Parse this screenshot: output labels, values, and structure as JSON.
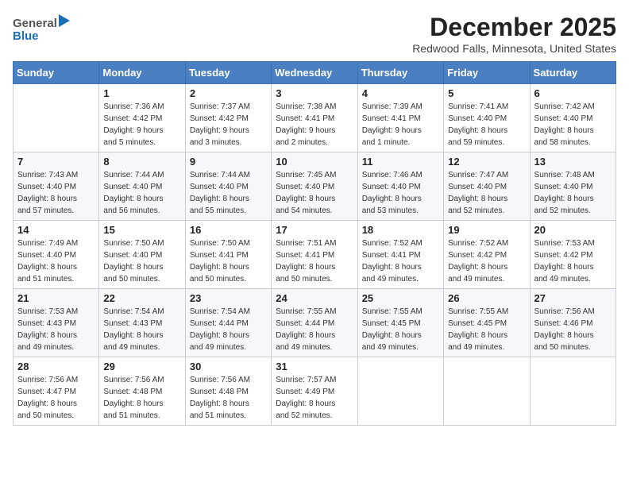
{
  "header": {
    "logo_general": "General",
    "logo_blue": "Blue",
    "month_title": "December 2025",
    "location": "Redwood Falls, Minnesota, United States"
  },
  "weekdays": [
    "Sunday",
    "Monday",
    "Tuesday",
    "Wednesday",
    "Thursday",
    "Friday",
    "Saturday"
  ],
  "weeks": [
    [
      {
        "day": "",
        "info": ""
      },
      {
        "day": "1",
        "info": "Sunrise: 7:36 AM\nSunset: 4:42 PM\nDaylight: 9 hours\nand 5 minutes."
      },
      {
        "day": "2",
        "info": "Sunrise: 7:37 AM\nSunset: 4:42 PM\nDaylight: 9 hours\nand 3 minutes."
      },
      {
        "day": "3",
        "info": "Sunrise: 7:38 AM\nSunset: 4:41 PM\nDaylight: 9 hours\nand 2 minutes."
      },
      {
        "day": "4",
        "info": "Sunrise: 7:39 AM\nSunset: 4:41 PM\nDaylight: 9 hours\nand 1 minute."
      },
      {
        "day": "5",
        "info": "Sunrise: 7:41 AM\nSunset: 4:40 PM\nDaylight: 8 hours\nand 59 minutes."
      },
      {
        "day": "6",
        "info": "Sunrise: 7:42 AM\nSunset: 4:40 PM\nDaylight: 8 hours\nand 58 minutes."
      }
    ],
    [
      {
        "day": "7",
        "info": "Sunrise: 7:43 AM\nSunset: 4:40 PM\nDaylight: 8 hours\nand 57 minutes."
      },
      {
        "day": "8",
        "info": "Sunrise: 7:44 AM\nSunset: 4:40 PM\nDaylight: 8 hours\nand 56 minutes."
      },
      {
        "day": "9",
        "info": "Sunrise: 7:44 AM\nSunset: 4:40 PM\nDaylight: 8 hours\nand 55 minutes."
      },
      {
        "day": "10",
        "info": "Sunrise: 7:45 AM\nSunset: 4:40 PM\nDaylight: 8 hours\nand 54 minutes."
      },
      {
        "day": "11",
        "info": "Sunrise: 7:46 AM\nSunset: 4:40 PM\nDaylight: 8 hours\nand 53 minutes."
      },
      {
        "day": "12",
        "info": "Sunrise: 7:47 AM\nSunset: 4:40 PM\nDaylight: 8 hours\nand 52 minutes."
      },
      {
        "day": "13",
        "info": "Sunrise: 7:48 AM\nSunset: 4:40 PM\nDaylight: 8 hours\nand 52 minutes."
      }
    ],
    [
      {
        "day": "14",
        "info": "Sunrise: 7:49 AM\nSunset: 4:40 PM\nDaylight: 8 hours\nand 51 minutes."
      },
      {
        "day": "15",
        "info": "Sunrise: 7:50 AM\nSunset: 4:40 PM\nDaylight: 8 hours\nand 50 minutes."
      },
      {
        "day": "16",
        "info": "Sunrise: 7:50 AM\nSunset: 4:41 PM\nDaylight: 8 hours\nand 50 minutes."
      },
      {
        "day": "17",
        "info": "Sunrise: 7:51 AM\nSunset: 4:41 PM\nDaylight: 8 hours\nand 50 minutes."
      },
      {
        "day": "18",
        "info": "Sunrise: 7:52 AM\nSunset: 4:41 PM\nDaylight: 8 hours\nand 49 minutes."
      },
      {
        "day": "19",
        "info": "Sunrise: 7:52 AM\nSunset: 4:42 PM\nDaylight: 8 hours\nand 49 minutes."
      },
      {
        "day": "20",
        "info": "Sunrise: 7:53 AM\nSunset: 4:42 PM\nDaylight: 8 hours\nand 49 minutes."
      }
    ],
    [
      {
        "day": "21",
        "info": "Sunrise: 7:53 AM\nSunset: 4:43 PM\nDaylight: 8 hours\nand 49 minutes."
      },
      {
        "day": "22",
        "info": "Sunrise: 7:54 AM\nSunset: 4:43 PM\nDaylight: 8 hours\nand 49 minutes."
      },
      {
        "day": "23",
        "info": "Sunrise: 7:54 AM\nSunset: 4:44 PM\nDaylight: 8 hours\nand 49 minutes."
      },
      {
        "day": "24",
        "info": "Sunrise: 7:55 AM\nSunset: 4:44 PM\nDaylight: 8 hours\nand 49 minutes."
      },
      {
        "day": "25",
        "info": "Sunrise: 7:55 AM\nSunset: 4:45 PM\nDaylight: 8 hours\nand 49 minutes."
      },
      {
        "day": "26",
        "info": "Sunrise: 7:55 AM\nSunset: 4:45 PM\nDaylight: 8 hours\nand 49 minutes."
      },
      {
        "day": "27",
        "info": "Sunrise: 7:56 AM\nSunset: 4:46 PM\nDaylight: 8 hours\nand 50 minutes."
      }
    ],
    [
      {
        "day": "28",
        "info": "Sunrise: 7:56 AM\nSunset: 4:47 PM\nDaylight: 8 hours\nand 50 minutes."
      },
      {
        "day": "29",
        "info": "Sunrise: 7:56 AM\nSunset: 4:48 PM\nDaylight: 8 hours\nand 51 minutes."
      },
      {
        "day": "30",
        "info": "Sunrise: 7:56 AM\nSunset: 4:48 PM\nDaylight: 8 hours\nand 51 minutes."
      },
      {
        "day": "31",
        "info": "Sunrise: 7:57 AM\nSunset: 4:49 PM\nDaylight: 8 hours\nand 52 minutes."
      },
      {
        "day": "",
        "info": ""
      },
      {
        "day": "",
        "info": ""
      },
      {
        "day": "",
        "info": ""
      }
    ]
  ]
}
